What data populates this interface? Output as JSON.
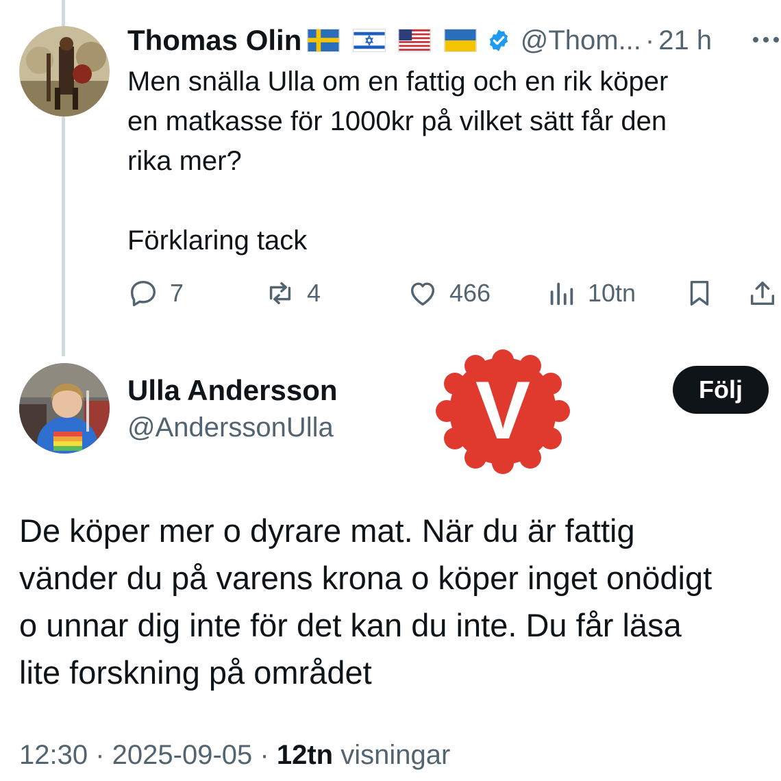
{
  "parent": {
    "name": "Thomas Olin",
    "flags": [
      "sweden-flag",
      "israel-flag",
      "usa-flag",
      "ukraine-flag"
    ],
    "verified_icon": "verified-badge-icon",
    "handle": "@Thom...",
    "separator": "·",
    "time": "21 h",
    "more_icon": "more-icon",
    "text": "Men snälla Ulla om en fattig och en rik köper\nen matkasse för 1000kr på vilket sätt får den\nrika mer?\n\nFörklaring tack",
    "actions": {
      "replies": "7",
      "reposts": "4",
      "likes": "466",
      "views": "10tn"
    }
  },
  "reply": {
    "name": "Ulla Andersson",
    "handle": "@AnderssonUlla",
    "follow_label": "Följ",
    "logo_letter": "V",
    "text": "De köper mer o dyrare mat. När du är fattig\nvänder du på varens krona o köper inget onödigt\no unnar dig inte för det kan du inte. Du får läsa\nlite forskning på området",
    "time": "12:30",
    "date": "2025-09-05",
    "views_count": "12tn",
    "views_label": "visningar"
  },
  "colors": {
    "text": "#0f1419",
    "secondary": "#536471",
    "verified": "#1d9bf0",
    "party_red": "#e03a2f",
    "follow_bg": "#0f1419"
  }
}
